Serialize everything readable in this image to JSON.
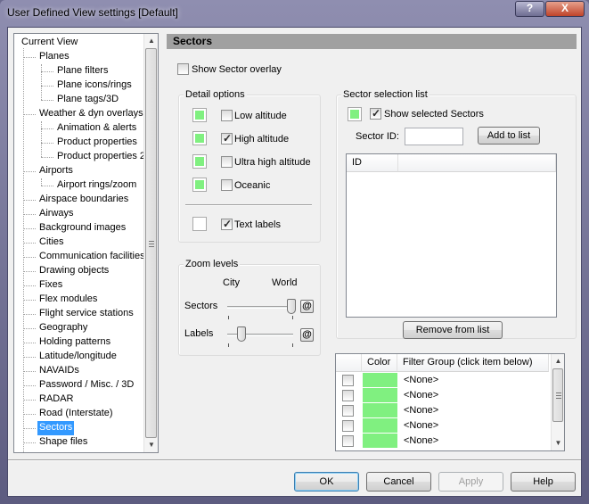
{
  "window": {
    "title": "User Defined View settings  [Default]",
    "help_label": "?",
    "close_label": "X"
  },
  "tree": {
    "items": [
      {
        "label": "Current View",
        "level": 0
      },
      {
        "label": "Planes",
        "level": 1
      },
      {
        "label": "Plane filters",
        "level": 2
      },
      {
        "label": "Plane icons/rings",
        "level": 2
      },
      {
        "label": "Plane tags/3D",
        "level": 2
      },
      {
        "label": "Weather & dyn overlays",
        "level": 1
      },
      {
        "label": "Animation & alerts",
        "level": 2
      },
      {
        "label": "Product properties",
        "level": 2
      },
      {
        "label": "Product properties 2",
        "level": 2
      },
      {
        "label": "Airports",
        "level": 1
      },
      {
        "label": "Airport rings/zoom",
        "level": 2
      },
      {
        "label": "Airspace boundaries",
        "level": 1
      },
      {
        "label": "Airways",
        "level": 1
      },
      {
        "label": "Background images",
        "level": 1
      },
      {
        "label": "Cities",
        "level": 1
      },
      {
        "label": "Communication facilities",
        "level": 1
      },
      {
        "label": "Drawing objects",
        "level": 1
      },
      {
        "label": "Fixes",
        "level": 1
      },
      {
        "label": "Flex modules",
        "level": 1
      },
      {
        "label": "Flight service stations",
        "level": 1
      },
      {
        "label": "Geography",
        "level": 1
      },
      {
        "label": "Holding patterns",
        "level": 1
      },
      {
        "label": "Latitude/longitude",
        "level": 1
      },
      {
        "label": "NAVAIDs",
        "level": 1
      },
      {
        "label": "Password / Misc. / 3D",
        "level": 1
      },
      {
        "label": "RADAR",
        "level": 1
      },
      {
        "label": "Road (Interstate)",
        "level": 1
      },
      {
        "label": "Sectors",
        "level": 1,
        "selected": true
      },
      {
        "label": "Shape files",
        "level": 1
      }
    ]
  },
  "panel": {
    "title": "Sectors",
    "show_overlay_label": "Show Sector overlay",
    "show_overlay_checked": false
  },
  "detail": {
    "title": "Detail options",
    "options": [
      {
        "label": "Low altitude",
        "checked": false
      },
      {
        "label": "High altitude",
        "checked": true
      },
      {
        "label": "Ultra high altitude",
        "checked": false
      },
      {
        "label": "Oceanic",
        "checked": false
      }
    ],
    "text_labels": {
      "label": "Text labels",
      "checked": true
    }
  },
  "zoom": {
    "title": "Zoom levels",
    "city_label": "City",
    "world_label": "World",
    "sectors_label": "Sectors",
    "labels_label": "Labels",
    "at_glyph": "@",
    "sectors_position": 1.0,
    "labels_position": 0.2
  },
  "selection": {
    "title": "Sector selection list",
    "show_selected_label": "Show selected Sectors",
    "show_selected_checked": true,
    "sector_id_label": "Sector ID:",
    "sector_id_value": "",
    "add_button": "Add to list",
    "list_header": "ID",
    "remove_button": "Remove from list"
  },
  "filter": {
    "col_color": "Color",
    "col_group": "Filter Group (click item below)",
    "rows": [
      "<None>",
      "<None>",
      "<None>",
      "<None>",
      "<None>"
    ]
  },
  "buttons": {
    "ok": "OK",
    "cancel": "Cancel",
    "apply": "Apply",
    "help": "Help"
  },
  "colors": {
    "swatch_green": "#80f080",
    "selection_blue": "#3399ff",
    "panel_header_gray": "#a0a0a0"
  }
}
